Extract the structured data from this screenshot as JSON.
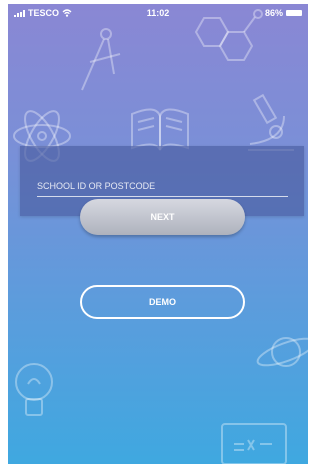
{
  "status_bar": {
    "carrier": "TESCO",
    "time": "11:02",
    "battery": "86%",
    "icons": [
      "signal-icon",
      "wifi-icon",
      "battery-icon"
    ]
  },
  "login": {
    "id_field_placeholder": "SCHOOL ID OR POSTCODE",
    "id_field_value": "",
    "next_label": "NEXT",
    "demo_label": "DEMO"
  },
  "background_doodles": [
    "compass-icon",
    "molecule-icon",
    "atom-icon",
    "book-icon",
    "microscope-icon",
    "planet-icon",
    "lightbulb-icon",
    "formula-board-icon"
  ],
  "colors": {
    "gradient_top": "#8a87d4",
    "gradient_bottom": "#3fa8e0",
    "card": "#4a5ca0",
    "next_button": "#c3c6cf",
    "text": "#ffffff"
  }
}
